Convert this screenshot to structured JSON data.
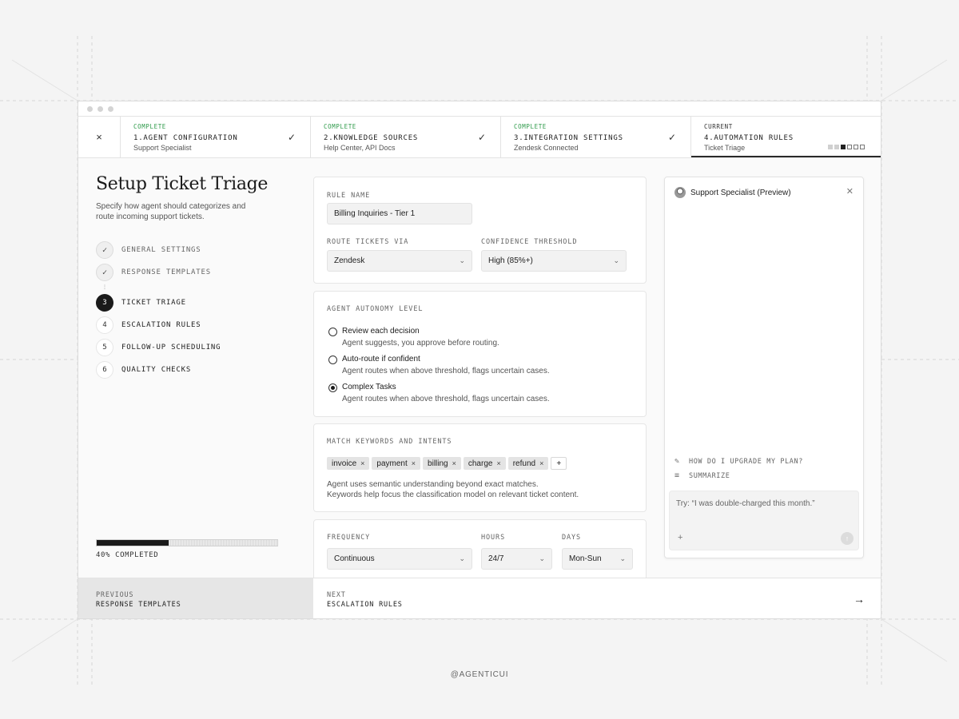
{
  "steps_bar": {
    "close_icon": "×",
    "steps": [
      {
        "status": "COMPLETE",
        "title": "1.AGENT CONFIGURATION",
        "subtitle": "Support Specialist"
      },
      {
        "status": "COMPLETE",
        "title": "2.KNOWLEDGE SOURCES",
        "subtitle": "Help Center, API Docs"
      },
      {
        "status": "COMPLETE",
        "title": "3.INTEGRATION SETTINGS",
        "subtitle": "Zendesk Connected"
      },
      {
        "status": "CURRENT",
        "title": "4.AUTOMATION RULES",
        "subtitle": "Ticket Triage"
      }
    ],
    "check_icon": "✓",
    "progress_squares": 7
  },
  "left": {
    "title": "Setup Ticket Triage",
    "description": "Specify how agent should categorizes and route incoming support tickets.",
    "substeps": [
      {
        "badge": "✓",
        "label": "GENERAL SETTINGS",
        "state": "done"
      },
      {
        "badge": "✓",
        "label": "RESPONSE TEMPLATES",
        "state": "done"
      },
      {
        "badge": "3",
        "label": "TICKET TRIAGE",
        "state": "active"
      },
      {
        "badge": "4",
        "label": "ESCALATION RULES",
        "state": "todo"
      },
      {
        "badge": "5",
        "label": "FOLLOW-UP SCHEDULING",
        "state": "todo"
      },
      {
        "badge": "6",
        "label": "QUALITY CHECKS",
        "state": "todo"
      }
    ],
    "progress_fraction": 0.4,
    "progress_text": "40% COMPLETED"
  },
  "rule": {
    "name_label": "RULE NAME",
    "name_value": "Billing Inquiries - Tier 1",
    "route_label": "ROUTE TICKETS VIA",
    "route_value": "Zendesk",
    "confidence_label": "CONFIDENCE THRESHOLD",
    "confidence_value": "High (85%+)"
  },
  "autonomy": {
    "label": "AGENT AUTONOMY LEVEL",
    "options": [
      {
        "title": "Review each decision",
        "desc": "Agent suggests, you approve before routing.",
        "selected": false
      },
      {
        "title": "Auto-route if confident",
        "desc": "Agent routes when above threshold, flags uncertain cases.",
        "selected": false
      },
      {
        "title": "Complex Tasks",
        "desc": "Agent routes when above threshold, flags uncertain cases.",
        "selected": true
      }
    ]
  },
  "keywords": {
    "label": "MATCH KEYWORDS AND INTENTS",
    "chips": [
      "invoice",
      "payment",
      "billing",
      "charge",
      "refund"
    ],
    "chip_remove": "×",
    "add": "+",
    "desc_line1": "Agent uses semantic understanding beyond exact matches.",
    "desc_line2": "Keywords help focus the classification model on relevant ticket content."
  },
  "schedule": {
    "frequency_label": "FREQUENCY",
    "frequency_value": "Continuous",
    "hours_label": "HOURS",
    "hours_value": "24/7",
    "days_label": "DAYS",
    "days_value": "Mon-Sun"
  },
  "preview": {
    "title": "Support Specialist (Preview)",
    "close": "✕",
    "suggestions": [
      {
        "icon": "edit-icon",
        "text": "HOW DO I UPGRADE MY PLAN?"
      },
      {
        "icon": "list-icon",
        "text": "SUMMARIZE"
      }
    ],
    "input_placeholder": "Try: “I was double-charged this month.”",
    "plus": "+",
    "send": "↑"
  },
  "footer": {
    "prev_small": "PREVIOUS",
    "prev_main": "RESPONSE TEMPLATES",
    "next_small": "NEXT",
    "next_main": "ESCALATION RULES",
    "arrow": "→"
  },
  "watermark": "@AGENTICUI",
  "colors": {
    "complete": "#2e9a4a",
    "accent": "#1a1a1a"
  }
}
